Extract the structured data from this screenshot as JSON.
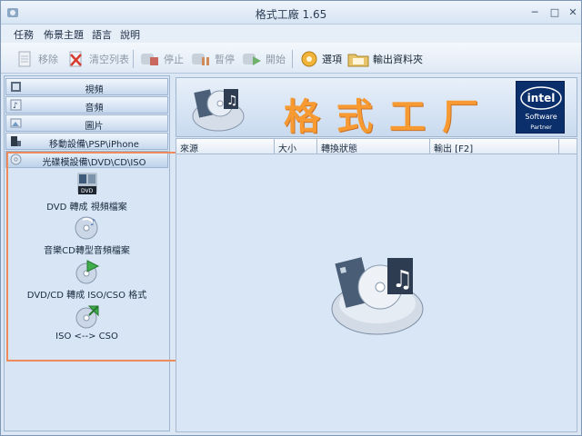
{
  "window": {
    "title": "格式工廠 1.65",
    "min": "─",
    "max": "□",
    "close": "✕"
  },
  "menu": [
    "任務",
    "佈景主題",
    "語言",
    "說明"
  ],
  "toolbar": {
    "remove": "移除",
    "clear": "清空列表",
    "stop": "停止",
    "pause": "暫停",
    "start": "開始",
    "options": "選項",
    "output_folder": "輸出資料夾"
  },
  "sidebar": {
    "categories": [
      "視頻",
      "音頻",
      "圖片",
      "移動設備\\PSP\\iPhone",
      "光碟模設備\\DVD\\CD\\ISO"
    ],
    "subitems": [
      "DVD 轉成 視頻檔案",
      "音樂CD轉型音頻檔案",
      "DVD/CD 轉成 ISO/CSO 格式",
      "ISO <--> CSO"
    ]
  },
  "banner": {
    "title": "格式工厂",
    "intel": "intel",
    "software": "Software",
    "partner": "Partner",
    "dvd": "DVD"
  },
  "list": {
    "columns": [
      "來源",
      "大小",
      "轉換狀態",
      "輸出 [F2]"
    ]
  },
  "colors": {
    "accent": "#f79a32",
    "highlight": "#ef8a5a",
    "intel": "#0b2f6b"
  }
}
